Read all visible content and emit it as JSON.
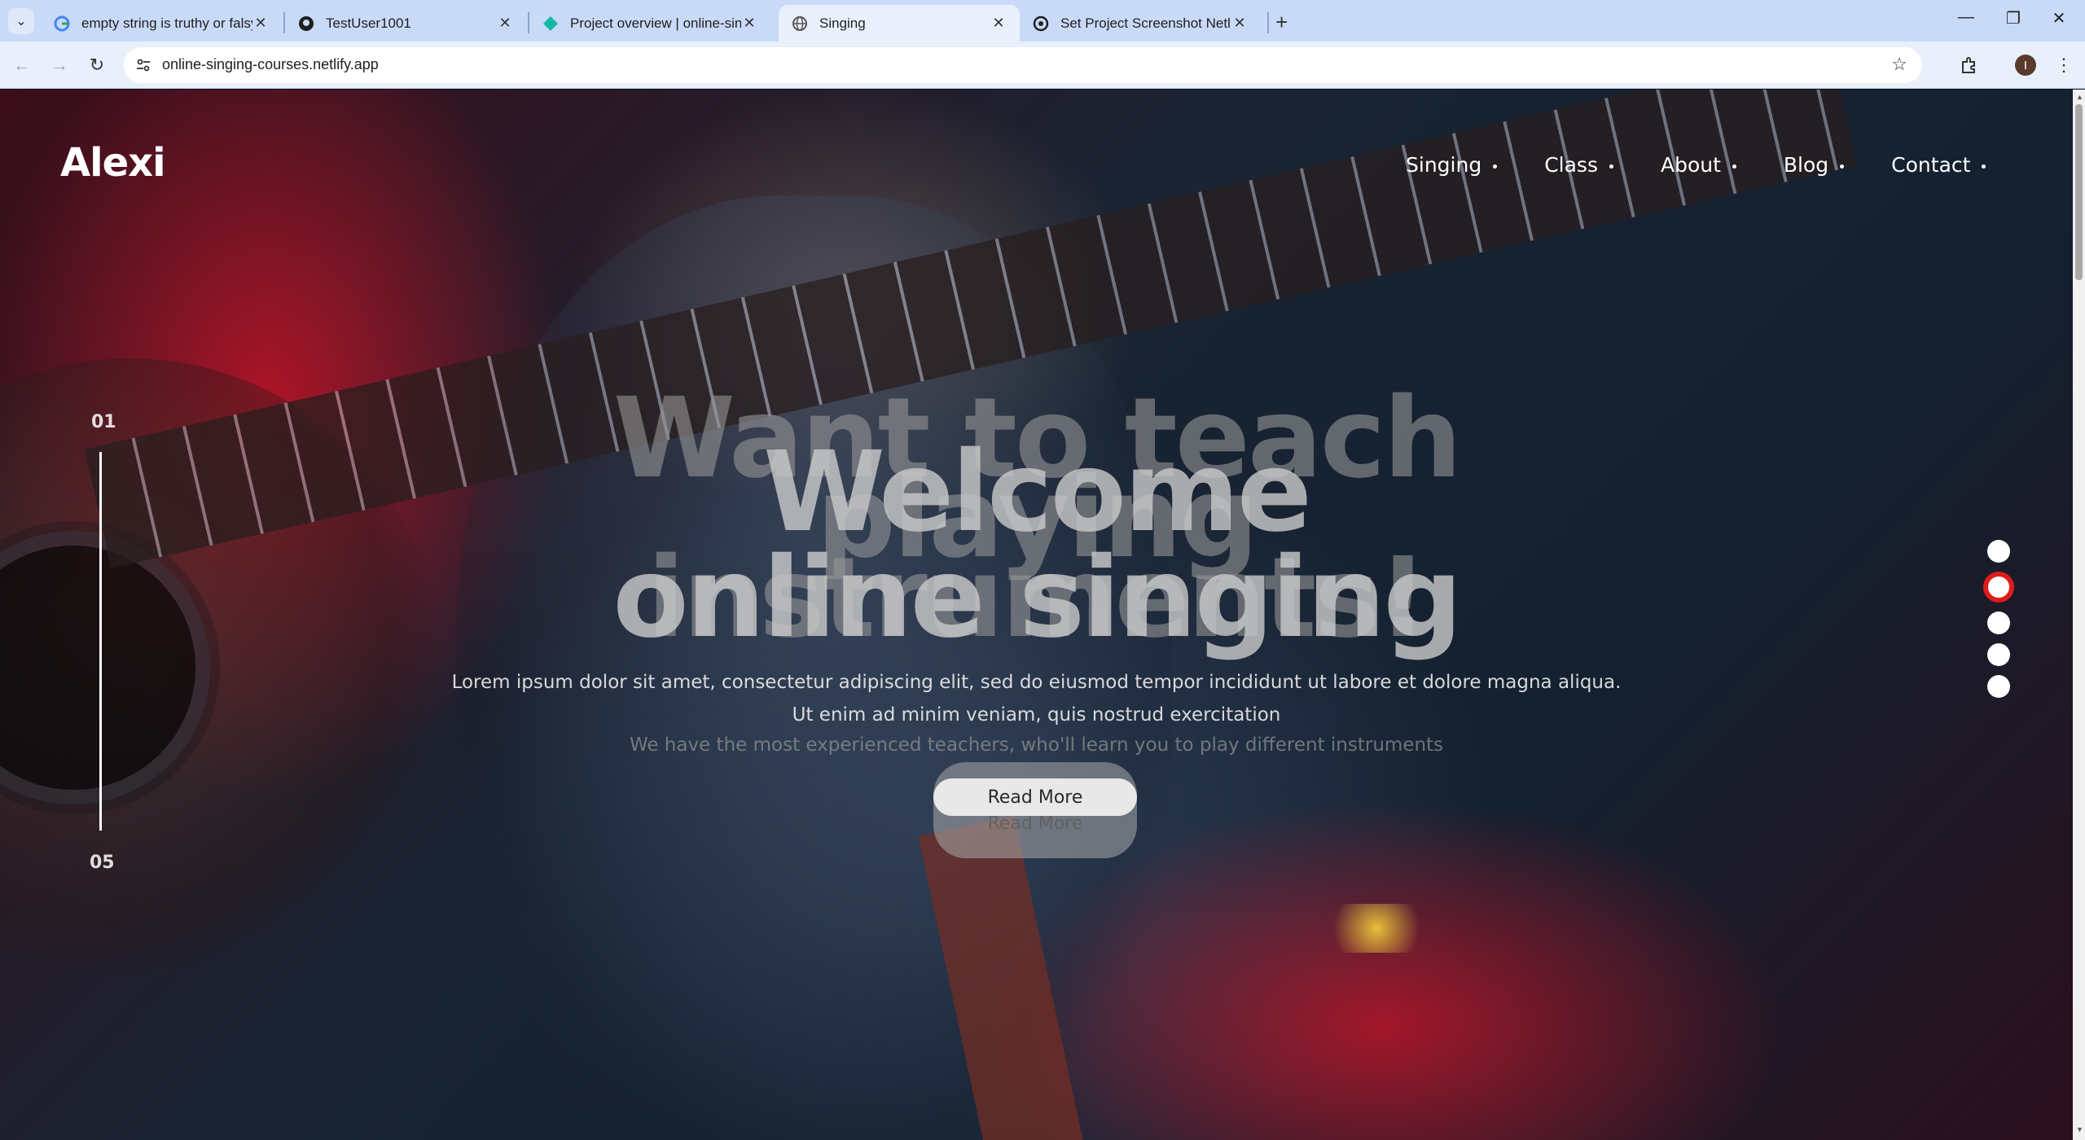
{
  "browser": {
    "tabs": [
      {
        "title": "empty string is truthy or falsy -",
        "icon": "google-icon"
      },
      {
        "title": "TestUser1001",
        "icon": "github-icon"
      },
      {
        "title": "Project overview | online-singin",
        "icon": "netlify-icon"
      },
      {
        "title": "Singing",
        "icon": "globe-icon",
        "active": true
      },
      {
        "title": "Set Project Screenshot Netlify",
        "icon": "openai-icon"
      }
    ],
    "url": "online-singing-courses.netlify.app",
    "profile_initial": "I"
  },
  "site": {
    "logo": "Alexi",
    "nav": [
      "Singing",
      "Class",
      "About",
      "Blog",
      "Contact"
    ],
    "counter": {
      "current": "01",
      "total": "05"
    },
    "hero": {
      "ghost_line1": "Want to teach",
      "ghost_line2": "playing",
      "ghost_line3": "instruments!",
      "title_line1": "Welcome",
      "title_line2": "online singing",
      "desc_line1": "Lorem ipsum dolor sit amet, consectetur adipiscing elit, sed do eiusmod tempor incididunt ut labore et dolore magna aliqua.",
      "desc_line2": "Ut enim ad minim veniam, quis nostrud exercitation",
      "ghost_desc": "We have the most experienced teachers, who'll learn you to play different instruments",
      "button": "Read More",
      "ghost_button": "Read More"
    },
    "pager": {
      "count": 5,
      "active_index": 1
    },
    "colors": {
      "accent": "#e01a1a",
      "tabstrip": "#c8daf7"
    }
  }
}
